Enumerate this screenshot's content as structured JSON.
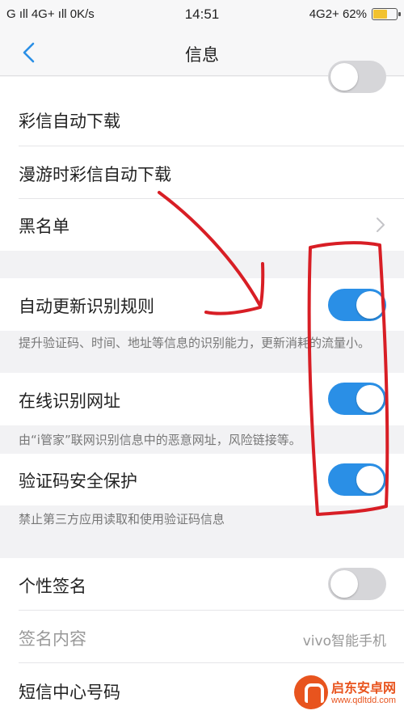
{
  "status_bar": {
    "left": "G ıll  4G+ ıll  0K/s",
    "time": "14:51",
    "right": "4G2+ 62%",
    "battery_level": 0.62,
    "battery_color": "#f2c230"
  },
  "nav": {
    "back_icon": "chevron-left-icon",
    "title": "信息"
  },
  "settings": {
    "mms_auto_download": "彩信自动下载",
    "roaming_mms_auto_download": "漫游时彩信自动下载",
    "blacklist": "黑名单",
    "auto_update_rules": {
      "label": "自动更新识别规则",
      "enabled": true,
      "desc": "提升验证码、时间、地址等信息的识别能力，更新消耗的流量小。"
    },
    "online_url_detection": {
      "label": "在线识别网址",
      "enabled": true,
      "desc": "由“i管家”联网识别信息中的恶意网址，风险链接等。"
    },
    "code_protection": {
      "label": "验证码安全保护",
      "enabled": true,
      "desc": "禁止第三方应用读取和使用验证码信息"
    },
    "signature": {
      "label": "个性签名",
      "enabled": false
    },
    "signature_content": {
      "label": "签名内容",
      "value": "vivo智能手机"
    },
    "sms_center": "短信中心号码"
  },
  "colors": {
    "toggle_on": "#2a8fe6",
    "toggle_off": "#d6d6d9",
    "annotation": "#d81e25"
  },
  "watermark": {
    "name": "启东安卓网",
    "url": "www.qdltdd.com"
  }
}
